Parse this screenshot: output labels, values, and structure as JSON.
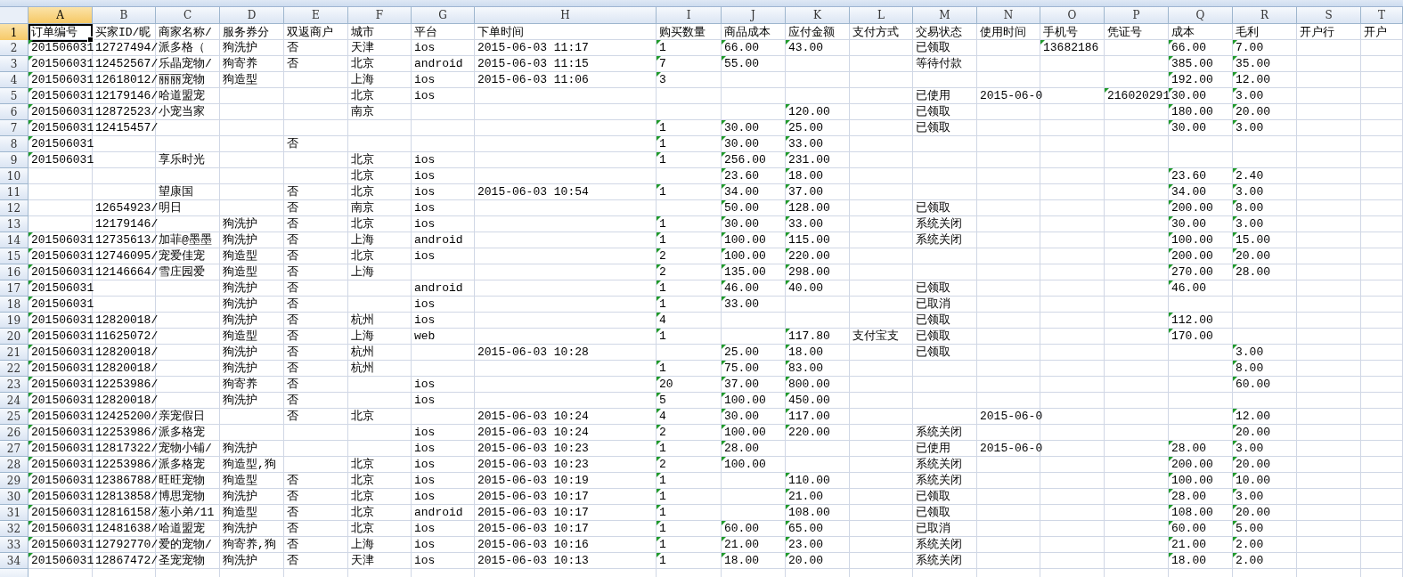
{
  "columns": [
    {
      "letter": "A",
      "selected": true,
      "flagged": true
    },
    {
      "letter": "B",
      "selected": false,
      "flagged": false
    },
    {
      "letter": "C",
      "selected": false,
      "flagged": false
    },
    {
      "letter": "D",
      "selected": false,
      "flagged": false
    },
    {
      "letter": "E",
      "selected": false,
      "flagged": false
    },
    {
      "letter": "F",
      "selected": false,
      "flagged": false
    },
    {
      "letter": "G",
      "selected": false,
      "flagged": false
    },
    {
      "letter": "H",
      "selected": false,
      "flagged": false
    },
    {
      "letter": "I",
      "selected": false,
      "flagged": true
    },
    {
      "letter": "J",
      "selected": false,
      "flagged": true
    },
    {
      "letter": "K",
      "selected": false,
      "flagged": true
    },
    {
      "letter": "L",
      "selected": false,
      "flagged": false
    },
    {
      "letter": "M",
      "selected": false,
      "flagged": false
    },
    {
      "letter": "N",
      "selected": false,
      "flagged": false
    },
    {
      "letter": "O",
      "selected": false,
      "flagged": true
    },
    {
      "letter": "P",
      "selected": false,
      "flagged": true
    },
    {
      "letter": "Q",
      "selected": false,
      "flagged": true
    },
    {
      "letter": "R",
      "selected": false,
      "flagged": true
    },
    {
      "letter": "S",
      "selected": false,
      "flagged": false
    },
    {
      "letter": "T",
      "selected": false,
      "flagged": false
    }
  ],
  "rows": [
    {
      "number": "1",
      "selected": true,
      "kind": "header",
      "cells": {
        "A": "订单编号",
        "B": "买家ID/昵",
        "C": "商家名称/",
        "D": "服务券分",
        "E": "双返商户",
        "F": "城市",
        "G": "平台",
        "H": "下单时间",
        "I": "购买数量",
        "J": "商品成本",
        "K": "应付金额",
        "L": "支付方式",
        "M": "交易状态",
        "N": "使用时间",
        "O": "手机号",
        "P": "凭证号",
        "Q": "成本",
        "R": "毛利",
        "S": "开户行",
        "T": "开户"
      }
    },
    {
      "number": "2",
      "selected": false,
      "kind": "data",
      "cells": {
        "A": "201506031",
        "B": "12727494/",
        "C": "派多格（",
        "D": "狗洗护",
        "E": "否",
        "F": "天津",
        "G": "ios",
        "H": "2015-06-03 11:17",
        "I": "1",
        "J": "66.00",
        "K": "43.00",
        "M": "已领取",
        "O": "13682186",
        "Q": "66.00",
        "R": "7.00"
      }
    },
    {
      "number": "3",
      "selected": false,
      "kind": "data",
      "cells": {
        "A": "201506031",
        "B": "12452567/",
        "C": "乐晶宠物/",
        "D": "狗寄养",
        "E": "否",
        "F": "北京",
        "G": "android",
        "H": "2015-06-03 11:15",
        "I": "7",
        "J": "55.00",
        "M": "等待付款",
        "Q": "385.00",
        "R": "35.00"
      }
    },
    {
      "number": "4",
      "selected": false,
      "kind": "data",
      "cells": {
        "A": "201506031",
        "B": "12618012/",
        "C": "丽丽宠物",
        "D": "狗造型",
        "F": "上海",
        "G": "ios",
        "H": "2015-06-03 11:06",
        "I": "3",
        "Q": "192.00",
        "R": "12.00"
      }
    },
    {
      "number": "5",
      "selected": false,
      "kind": "data",
      "cells": {
        "A": "201506031",
        "B": "12179146/",
        "C": "哈道盟宠",
        "F": "北京",
        "G": "ios",
        "M": "已使用",
        "N": "2015-06-0",
        "P": "216020291",
        "Q": "30.00",
        "R": "3.00"
      }
    },
    {
      "number": "6",
      "selected": false,
      "kind": "data",
      "cells": {
        "A": "201506031",
        "B": "12872523/",
        "C": "小宠当家",
        "F": "南京",
        "K": "120.00",
        "M": "已领取",
        "Q": "180.00",
        "R": "20.00"
      }
    },
    {
      "number": "7",
      "selected": false,
      "kind": "data",
      "cells": {
        "A": "201506031",
        "B": "12415457/",
        "I": "1",
        "J": "30.00",
        "K": "25.00",
        "M": "已领取",
        "Q": "30.00",
        "R": "3.00"
      }
    },
    {
      "number": "8",
      "selected": false,
      "kind": "data",
      "cells": {
        "A": "201506031",
        "E": "否",
        "I": "1",
        "J": "30.00",
        "K": "33.00"
      }
    },
    {
      "number": "9",
      "selected": false,
      "kind": "data",
      "cells": {
        "A": "201506031",
        "C": "享乐时光",
        "F": "北京",
        "G": "ios",
        "I": "1",
        "J": "256.00",
        "K": "231.00"
      }
    },
    {
      "number": "10",
      "selected": false,
      "kind": "data",
      "cells": {
        "F": "北京",
        "G": "ios",
        "J": "23.60",
        "K": "18.00",
        "Q": "23.60",
        "R": "2.40"
      }
    },
    {
      "number": "11",
      "selected": false,
      "kind": "data",
      "cells": {
        "C": "望康国",
        "E": "否",
        "F": "北京",
        "G": "ios",
        "H": "2015-06-03 10:54",
        "I": "1",
        "J": "34.00",
        "K": "37.00",
        "Q": "34.00",
        "R": "3.00"
      }
    },
    {
      "number": "12",
      "selected": false,
      "kind": "data",
      "cells": {
        "B": "12654923/",
        "C": "明日",
        "E": "否",
        "F": "南京",
        "G": "ios",
        "J": "50.00",
        "K": "128.00",
        "M": "已领取",
        "Q": "200.00",
        "R": "8.00"
      }
    },
    {
      "number": "13",
      "selected": false,
      "kind": "data",
      "cells": {
        "B": "12179146/",
        "D": "狗洗护",
        "E": "否",
        "F": "北京",
        "G": "ios",
        "I": "1",
        "J": "30.00",
        "K": "33.00",
        "M": "系统关闭",
        "Q": "30.00",
        "R": "3.00"
      }
    },
    {
      "number": "14",
      "selected": false,
      "kind": "data",
      "cells": {
        "A": "201506031",
        "B": "12735613/",
        "C": "加菲@墨墨",
        "D": "狗洗护",
        "E": "否",
        "F": "上海",
        "G": "android",
        "I": "1",
        "J": "100.00",
        "K": "115.00",
        "M": "系统关闭",
        "Q": "100.00",
        "R": "15.00"
      }
    },
    {
      "number": "15",
      "selected": false,
      "kind": "data",
      "cells": {
        "A": "201506031",
        "B": "12746095/",
        "C": "宠爱佳宠",
        "D": "狗造型",
        "E": "否",
        "F": "北京",
        "G": "ios",
        "I": "2",
        "J": "100.00",
        "K": "220.00",
        "Q": "200.00",
        "R": "20.00"
      }
    },
    {
      "number": "16",
      "selected": false,
      "kind": "data",
      "cells": {
        "A": "201506031",
        "B": "12146664/",
        "C": "雪庄园爱",
        "D": "狗造型",
        "E": "否",
        "F": "上海",
        "I": "2",
        "J": "135.00",
        "K": "298.00",
        "Q": "270.00",
        "R": "28.00"
      }
    },
    {
      "number": "17",
      "selected": false,
      "kind": "data",
      "cells": {
        "A": "201506031",
        "D": "狗洗护",
        "E": "否",
        "G": "android",
        "I": "1",
        "J": "46.00",
        "K": "40.00",
        "M": "已领取",
        "Q": "46.00"
      }
    },
    {
      "number": "18",
      "selected": false,
      "kind": "data",
      "cells": {
        "A": "201506031",
        "D": "狗洗护",
        "E": "否",
        "G": "ios",
        "I": "1",
        "J": "33.00",
        "M": "已取消"
      }
    },
    {
      "number": "19",
      "selected": false,
      "kind": "data",
      "cells": {
        "A": "201506031",
        "B": "12820018/",
        "D": "狗洗护",
        "E": "否",
        "F": "杭州",
        "G": "ios",
        "I": "4",
        "M": "已领取",
        "Q": "112.00"
      }
    },
    {
      "number": "20",
      "selected": false,
      "kind": "data",
      "cells": {
        "A": "201506031",
        "B": "11625072/",
        "D": "狗造型",
        "E": "否",
        "F": "上海",
        "G": "web",
        "I": "1",
        "K": "117.80",
        "L": "支付宝支",
        "M": "已领取",
        "Q": "170.00"
      }
    },
    {
      "number": "21",
      "selected": false,
      "kind": "data",
      "cells": {
        "A": "201506031",
        "B": "12820018/",
        "D": "狗洗护",
        "E": "否",
        "F": "杭州",
        "H": "2015-06-03 10:28",
        "J": "25.00",
        "K": "18.00",
        "M": "已领取",
        "R": "3.00"
      }
    },
    {
      "number": "22",
      "selected": false,
      "kind": "data",
      "cells": {
        "A": "201506031",
        "B": "12820018/",
        "D": "狗洗护",
        "E": "否",
        "F": "杭州",
        "I": "1",
        "J": "75.00",
        "K": "83.00",
        "R": "8.00"
      }
    },
    {
      "number": "23",
      "selected": false,
      "kind": "data",
      "cells": {
        "A": "201506031",
        "B": "12253986/",
        "D": "狗寄养",
        "E": "否",
        "G": "ios",
        "I": "20",
        "J": "37.00",
        "K": "800.00",
        "R": "60.00"
      }
    },
    {
      "number": "24",
      "selected": false,
      "kind": "data",
      "cells": {
        "A": "201506031",
        "B": "12820018/",
        "D": "狗洗护",
        "E": "否",
        "G": "ios",
        "I": "5",
        "J": "100.00",
        "K": "450.00"
      }
    },
    {
      "number": "25",
      "selected": false,
      "kind": "data",
      "cells": {
        "A": "201506031",
        "B": "12425200/",
        "C": "亲宠假日",
        "E": "否",
        "F": "北京",
        "H": "2015-06-03 10:24",
        "I": "4",
        "J": "30.00",
        "K": "117.00",
        "N": "2015-06-0",
        "R": "12.00"
      }
    },
    {
      "number": "26",
      "selected": false,
      "kind": "data",
      "cells": {
        "A": "201506031",
        "B": "12253986/",
        "C": "派多格宠",
        "G": "ios",
        "H": "2015-06-03 10:24",
        "I": "2",
        "J": "100.00",
        "K": "220.00",
        "M": "系统关闭",
        "R": "20.00"
      }
    },
    {
      "number": "27",
      "selected": false,
      "kind": "data",
      "cells": {
        "A": "201506031",
        "B": "12817322/",
        "C": "宠物小铺/",
        "D": "狗洗护",
        "G": "ios",
        "H": "2015-06-03 10:23",
        "I": "1",
        "J": "28.00",
        "M": "已使用",
        "N": "2015-06-0",
        "Q": "28.00",
        "R": "3.00"
      }
    },
    {
      "number": "28",
      "selected": false,
      "kind": "data",
      "cells": {
        "A": "201506031",
        "B": "12253986/",
        "C": "派多格宠",
        "D": "狗造型,狗",
        "F": "北京",
        "G": "ios",
        "H": "2015-06-03 10:23",
        "I": "2",
        "J": "100.00",
        "M": "系统关闭",
        "Q": "200.00",
        "R": "20.00"
      }
    },
    {
      "number": "29",
      "selected": false,
      "kind": "data",
      "cells": {
        "A": "201506031",
        "B": "12386788/",
        "C": "旺旺宠物",
        "D": "狗造型",
        "E": "否",
        "F": "北京",
        "G": "ios",
        "H": "2015-06-03 10:19",
        "I": "1",
        "K": "110.00",
        "M": "系统关闭",
        "Q": "100.00",
        "R": "10.00"
      }
    },
    {
      "number": "30",
      "selected": false,
      "kind": "data",
      "cells": {
        "A": "201506031",
        "B": "12813858/",
        "C": "博思宠物",
        "D": "狗洗护",
        "E": "否",
        "F": "北京",
        "G": "ios",
        "H": "2015-06-03 10:17",
        "I": "1",
        "K": "21.00",
        "M": "已领取",
        "Q": "28.00",
        "R": "3.00"
      }
    },
    {
      "number": "31",
      "selected": false,
      "kind": "data",
      "cells": {
        "A": "201506031",
        "B": "12816158/",
        "C": "葱小弟/11",
        "D": "狗造型",
        "E": "否",
        "F": "北京",
        "G": "android",
        "H": "2015-06-03 10:17",
        "I": "1",
        "K": "108.00",
        "M": "已领取",
        "Q": "108.00",
        "R": "20.00"
      }
    },
    {
      "number": "32",
      "selected": false,
      "kind": "data",
      "cells": {
        "A": "201506031",
        "B": "12481638/",
        "C": "哈道盟宠",
        "D": "狗洗护",
        "E": "否",
        "F": "北京",
        "G": "ios",
        "H": "2015-06-03 10:17",
        "I": "1",
        "J": "60.00",
        "K": "65.00",
        "M": "已取消",
        "Q": "60.00",
        "R": "5.00"
      }
    },
    {
      "number": "33",
      "selected": false,
      "kind": "data",
      "cells": {
        "A": "201506031",
        "B": "12792770/",
        "C": "爱的宠物/",
        "D": "狗寄养,狗",
        "E": "否",
        "F": "上海",
        "G": "ios",
        "H": "2015-06-03 10:16",
        "I": "1",
        "J": "21.00",
        "K": "23.00",
        "M": "系统关闭",
        "Q": "21.00",
        "R": "2.00"
      }
    },
    {
      "number": "34",
      "selected": false,
      "kind": "data",
      "cells": {
        "A": "201506031",
        "B": "12867472/",
        "C": "圣宠宠物",
        "D": "狗洗护",
        "E": "否",
        "F": "天津",
        "G": "ios",
        "H": "2015-06-03 10:13",
        "I": "1",
        "J": "18.00",
        "K": "20.00",
        "M": "系统关闭",
        "Q": "18.00",
        "R": "2.00"
      }
    }
  ]
}
